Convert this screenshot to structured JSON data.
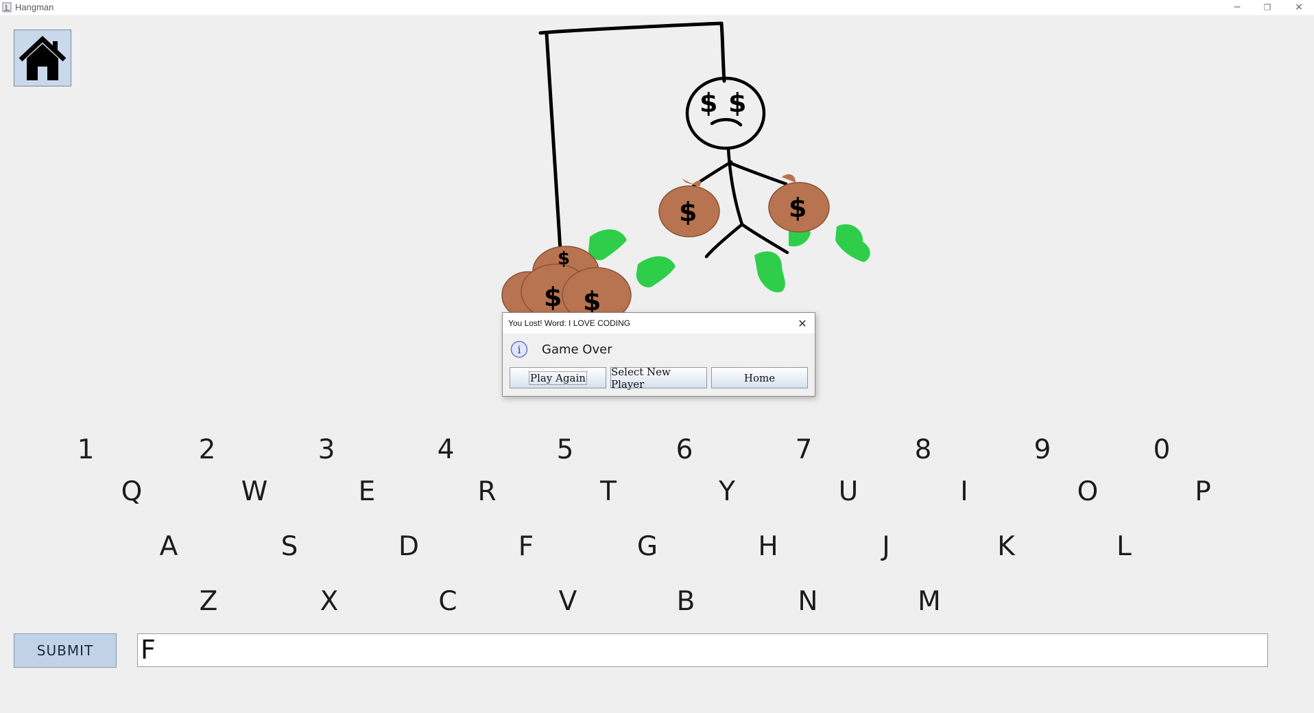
{
  "window": {
    "title": "Hangman",
    "minimize_glyph": "─",
    "restore_glyph": "❐",
    "close_glyph": "✕"
  },
  "home_button": {
    "icon": "house-icon"
  },
  "drawing": {
    "description_icons": [
      "gallows",
      "stick-figure",
      "dollar-eyes",
      "money-bags",
      "cash-bills"
    ],
    "colors": {
      "bag": "#b87350",
      "cash": "#2fce4a",
      "line": "#000000"
    },
    "bag_symbol": "$"
  },
  "keyboard": {
    "row1": [
      "1",
      "2",
      "3",
      "4",
      "5",
      "6",
      "7",
      "8",
      "9",
      "0"
    ],
    "row2": [
      "Q",
      "W",
      "E",
      "R",
      "T",
      "Y",
      "U",
      "I",
      "O",
      "P"
    ],
    "row3": [
      "A",
      "S",
      "D",
      "F",
      "G",
      "H",
      "J",
      "K",
      "L"
    ],
    "row4": [
      "Z",
      "X",
      "C",
      "V",
      "B",
      "N",
      "M"
    ]
  },
  "submit": {
    "label": "SUBMIT"
  },
  "guess_input": {
    "value": "F"
  },
  "dialog": {
    "title": "You Lost! Word: I LOVE CODING",
    "close_glyph": "✕",
    "info_icon_glyph": "i",
    "message": "Game Over",
    "buttons": {
      "play_again": "Play Again",
      "select_new_player": "Select New Player",
      "home": "Home"
    }
  }
}
